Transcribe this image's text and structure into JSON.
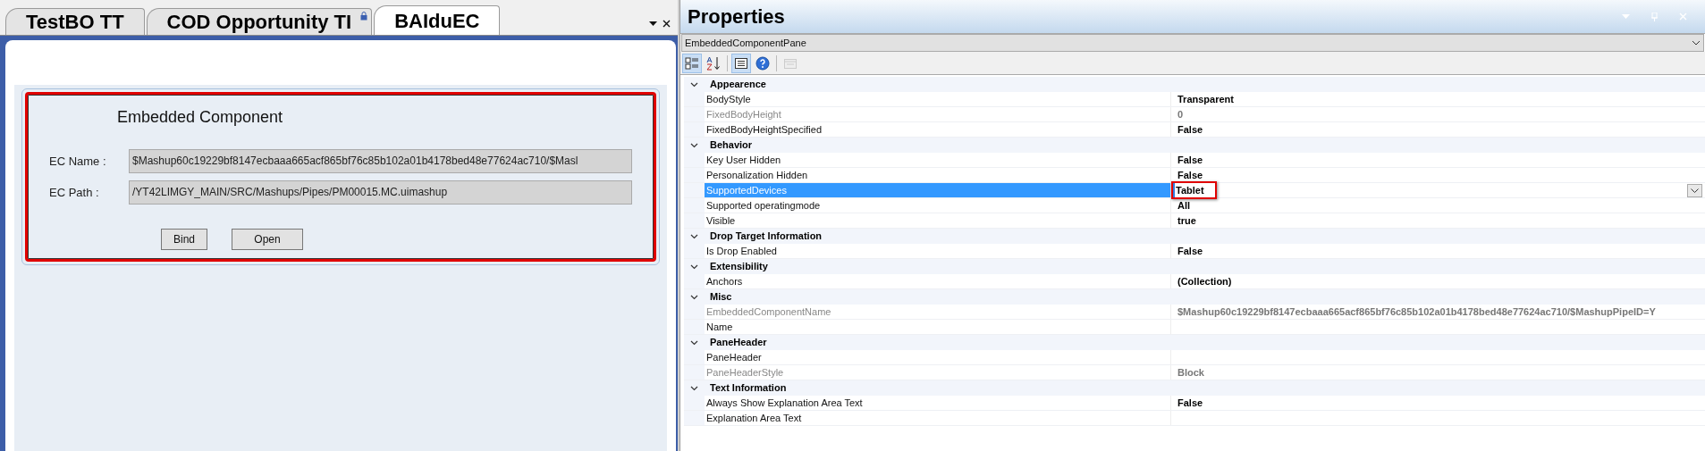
{
  "document_tabs": [
    {
      "label": "TestBO TT",
      "selected": false,
      "locked": false
    },
    {
      "label": "COD Opportunity TI",
      "selected": false,
      "locked": true
    },
    {
      "label": "BAIduEC",
      "selected": true,
      "locked": false
    }
  ],
  "embedded_component": {
    "title": "Embedded Component",
    "fields": [
      {
        "label": "EC Name :",
        "value": "$Mashup60c19229bf8147ecbaaa665acf865bf76c85b102a01b4178bed48e77624ac710/$Masl"
      },
      {
        "label": "EC Path :",
        "value": "/YT42LIMGY_MAIN/SRC/Mashups/Pipes/PM00015.MC.uimashup"
      }
    ],
    "buttons": [
      "Bind",
      "Open"
    ]
  },
  "properties": {
    "title": "Properties",
    "object_selector": "EmbeddedComponentPane",
    "toolbar": [
      {
        "kind": "categorized",
        "selected": true,
        "disabled": false
      },
      {
        "kind": "alphabetical",
        "selected": false,
        "disabled": false
      },
      {
        "kind": "properties",
        "selected": true,
        "disabled": false
      },
      {
        "kind": "help",
        "selected": false,
        "disabled": false
      },
      {
        "kind": "pages",
        "selected": false,
        "disabled": true
      }
    ],
    "groups": [
      {
        "name": "Appearence",
        "expanded": true,
        "items": [
          {
            "name": "BodyStyle",
            "value": "Transparent",
            "disabled": false,
            "selected": false,
            "highlighted": false
          },
          {
            "name": "FixedBodyHeight",
            "value": "0",
            "disabled": true,
            "selected": false,
            "highlighted": false
          },
          {
            "name": "FixedBodyHeightSpecified",
            "value": "False",
            "disabled": false,
            "selected": false,
            "highlighted": false
          }
        ]
      },
      {
        "name": "Behavior",
        "expanded": true,
        "items": [
          {
            "name": "Key User Hidden",
            "value": "False",
            "disabled": false,
            "selected": false,
            "highlighted": false
          },
          {
            "name": "Personalization Hidden",
            "value": "False",
            "disabled": false,
            "selected": false,
            "highlighted": false
          },
          {
            "name": "SupportedDevices",
            "value": "Tablet",
            "disabled": false,
            "selected": true,
            "highlighted": true
          },
          {
            "name": "Supported operatingmode",
            "value": "All",
            "disabled": false,
            "selected": false,
            "highlighted": false
          },
          {
            "name": "Visible",
            "value": "true",
            "disabled": false,
            "selected": false,
            "highlighted": false
          }
        ]
      },
      {
        "name": "Drop Target Information",
        "expanded": true,
        "items": [
          {
            "name": "Is Drop Enabled",
            "value": "False",
            "disabled": false,
            "selected": false,
            "highlighted": false
          }
        ]
      },
      {
        "name": "Extensibility",
        "expanded": true,
        "items": [
          {
            "name": "Anchors",
            "value": "(Collection)",
            "disabled": false,
            "selected": false,
            "highlighted": false
          }
        ]
      },
      {
        "name": "Misc",
        "expanded": true,
        "items": [
          {
            "name": "EmbeddedComponentName",
            "value": "$Mashup60c19229bf8147ecbaaa665acf865bf76c85b102a01b4178bed48e77624ac710/$MashupPipeID=Y",
            "disabled": true,
            "selected": false,
            "highlighted": false
          },
          {
            "name": "Name",
            "value": "",
            "disabled": false,
            "selected": false,
            "highlighted": false
          }
        ]
      },
      {
        "name": "PaneHeader",
        "expanded": true,
        "items": [
          {
            "name": "PaneHeader",
            "value": "",
            "disabled": false,
            "selected": false,
            "highlighted": false
          },
          {
            "name": "PaneHeaderStyle",
            "value": "Block",
            "disabled": true,
            "selected": false,
            "highlighted": false
          }
        ]
      },
      {
        "name": "Text Information",
        "expanded": true,
        "items": [
          {
            "name": "Always Show Explanation Area Text",
            "value": "False",
            "disabled": false,
            "selected": false,
            "highlighted": false
          },
          {
            "name": "Explanation Area Text",
            "value": "",
            "disabled": false,
            "selected": false,
            "highlighted": false
          }
        ]
      }
    ]
  }
}
